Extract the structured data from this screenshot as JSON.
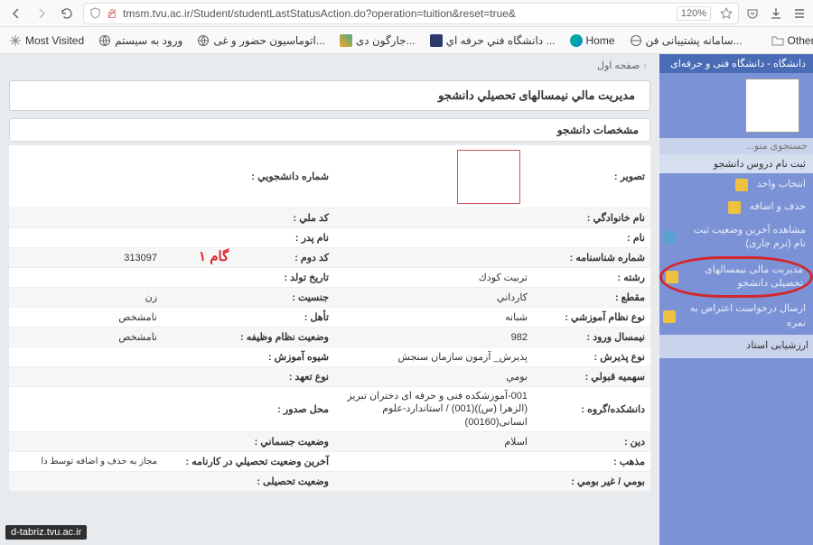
{
  "browser": {
    "url": "tmsm.tvu.ac.ir/Student/studentLastStatusAction.do?operation=tuition&reset=true&",
    "zoom": "120%",
    "bookmarks": {
      "mostVisited": "Most Visited",
      "loginSystem": "ورود به سیستم",
      "attendanceAuto": "اتوماسیون حضور و غی...",
      "jargunDi": "جارگون دی...",
      "uniTechPro": "دانشگاه فني حرفه اي ...",
      "home": "Home",
      "supportSys": "سامانه پشتیبانی فن...",
      "otherBookmarks": "Other Bookmarks"
    }
  },
  "page": {
    "siteTitle": "دانشگاه - دانشگاه فنی و حرفه‌ای",
    "searchPlaceholder": "جستجوی منو...",
    "sidebarHeader": "ثبت نام دروس دانشجو",
    "menu": {
      "selectUnit": "انتخاب واحد",
      "addDrop": "حذف و اضافه",
      "viewLastStatus": "مشاهده آخرین وضعیت ثبت نام (ترم جاری)",
      "financeMgmt": "مدیریت مالی نیمسالهای تحصیلی دانشجو",
      "sendObjection": "ارسال درخواست اعتراض به نمره",
      "evalTeacher": "ارزشیابی استاد"
    },
    "breadcrumb": "صفحه اول",
    "panelTitle": "مدیریت مالي نیمسالهای تحصیلي دانشجو",
    "sectionTitle": "مشخصات دانشجو",
    "stepLabel": "گام ۱",
    "labels": {
      "photo": "تصویر :",
      "studentNo": "شماره دانشجویي :",
      "familyName": "نام خانوادگي :",
      "nationalCode": "کد ملي :",
      "name": "نام :",
      "fatherName": "نام پدر :",
      "idNumber": "شماره شناسنامه :",
      "secondCode": "کد دوم :",
      "field": "رشته :",
      "birthDate": "تاریخ تولد :",
      "level": "مقطع :",
      "gender": "جنسیت :",
      "eduType": "نوع نظام آموزشي :",
      "maritalStatus": "تأهل :",
      "entrySem": "نیمسال ورود :",
      "militaryStatus": "وضعیت نظام وظیفه :",
      "admissionType": "نوع پذیرش :",
      "learningMethod": "شیوه آموزش :",
      "admissionQuota": "سهمیه قبولي :",
      "commitmentType": "نوع تعهد :",
      "faculty": "دانشکده/گروه :",
      "issuePlace": "محل صدور :",
      "religion": "دین :",
      "physicalStatus": "وضعیت جسماني :",
      "sect": "مذهب :",
      "lastTranscriptStatus": "آخرین وضعیت تحصیلي در کارنامه :",
      "localNonlocal": "بومي / غیر بومي :",
      "eduStatus": "وضعیت تحصیلی :",
      "transferNote": "مجاز به حذف و اضافه توسط دا"
    },
    "values": {
      "secondCode": "313097",
      "field": "تربیت کودك",
      "level": "کارداني",
      "gender": "زن",
      "eduType": "شبانه",
      "maritalStatus": "نامشخص",
      "entrySem": "982",
      "militaryStatus": "نامشخص",
      "admissionType": "پذیرش_ آزمون سازمان سنجش",
      "admissionQuota": "بومي",
      "faculty": "001-آموزشکده فنی و حرفه ای دختران تبریز (الزهرا (س))(001) / استاندارد-علوم انسانی(00160)",
      "religion": "اسلام"
    },
    "watermark": "d-tabriz.tvu.ac.ir"
  }
}
